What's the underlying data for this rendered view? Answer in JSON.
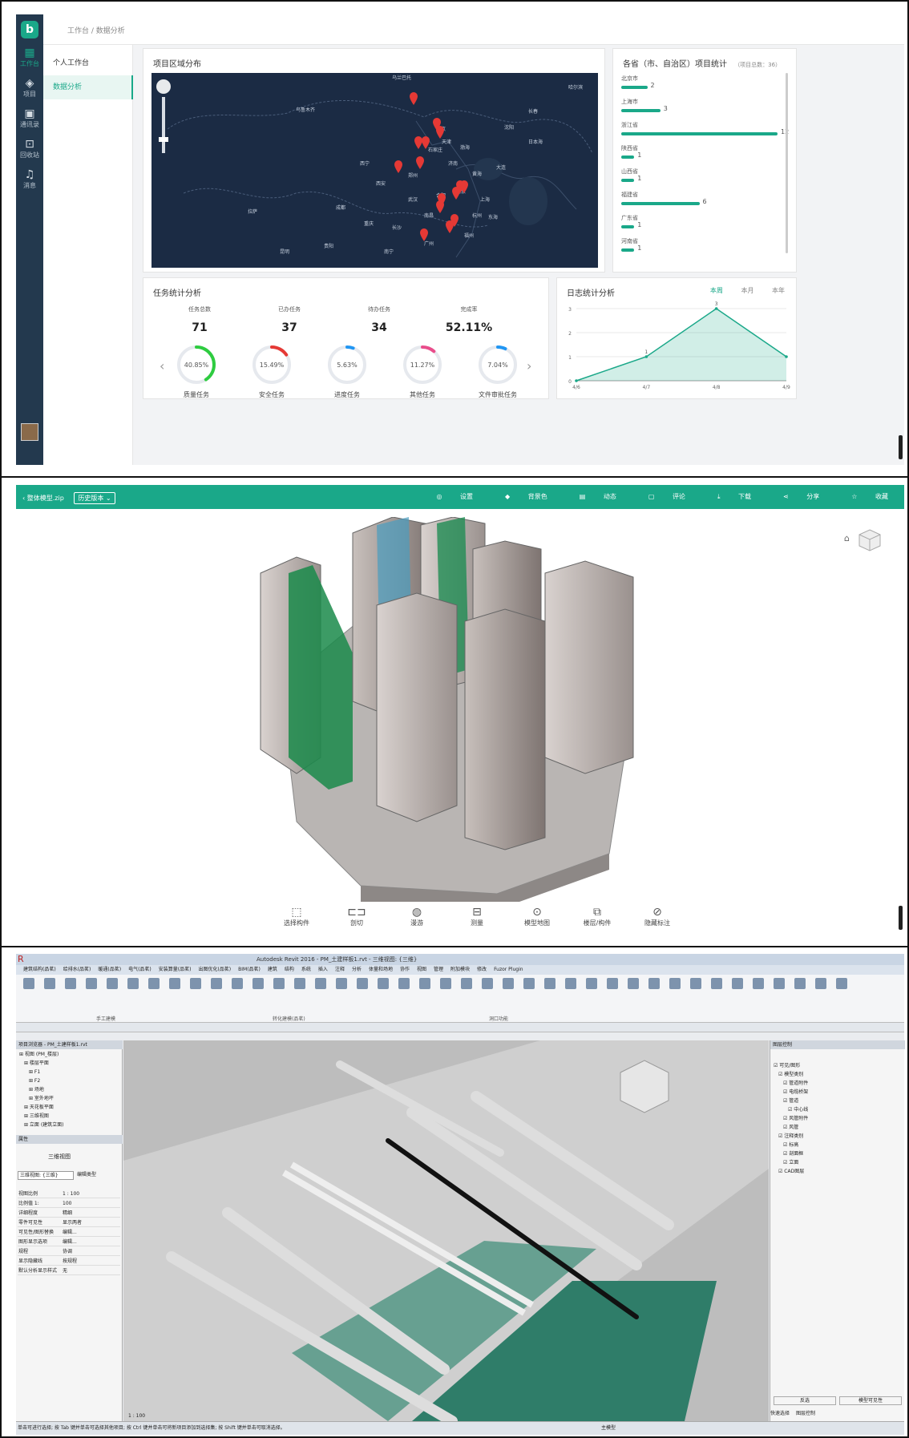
{
  "dashboard": {
    "breadcrumb": "工作台 / 数据分析",
    "sidebar": [
      {
        "label": "工作台",
        "icon": "grid-icon"
      },
      {
        "label": "项目",
        "icon": "layers-icon"
      },
      {
        "label": "通讯录",
        "icon": "contacts-icon"
      },
      {
        "label": "回收站",
        "icon": "trash-icon"
      },
      {
        "label": "消息",
        "icon": "bell-icon"
      }
    ],
    "subnav": [
      "个人工作台",
      "数据分析"
    ],
    "map_card": {
      "title": "项目区域分布",
      "labels": [
        "乌兰巴托",
        "乌鲁木齐",
        "北京",
        "天津",
        "石家庄",
        "渤海",
        "黄海",
        "东海",
        "日本海",
        "上海",
        "西宁",
        "成都",
        "重庆",
        "贵阳",
        "长沙",
        "武汉",
        "南昌",
        "郑州",
        "西安",
        "昆明",
        "拉萨",
        "南宁",
        "广州",
        "福州",
        "杭州",
        "合肥",
        "南京",
        "济南",
        "沈阳",
        "长春",
        "大连",
        "哈尔滨"
      ]
    },
    "province_card": {
      "title": "各省（市、自治区）项目统计",
      "total": "（项目总数：36）",
      "items": [
        {
          "name": "北京市",
          "value": 2
        },
        {
          "name": "上海市",
          "value": 3
        },
        {
          "name": "浙江省",
          "value": 12
        },
        {
          "name": "陕西省",
          "value": 1
        },
        {
          "name": "山西省",
          "value": 1
        },
        {
          "name": "福建省",
          "value": 6
        },
        {
          "name": "广东省",
          "value": 1
        },
        {
          "name": "河南省",
          "value": 1
        }
      ]
    },
    "task_card": {
      "title": "任务统计分析",
      "headers": [
        "任务总数",
        "已办任务",
        "待办任务",
        "完成率"
      ],
      "values": [
        "71",
        "37",
        "34",
        "52.11%"
      ],
      "rings": [
        {
          "label": "质量任务",
          "pct": "40.85%",
          "value": 40.85,
          "color": "#2ecc40"
        },
        {
          "label": "安全任务",
          "pct": "15.49%",
          "value": 15.49,
          "color": "#e53935"
        },
        {
          "label": "进度任务",
          "pct": "5.63%",
          "value": 5.63,
          "color": "#2196f3"
        },
        {
          "label": "其他任务",
          "pct": "11.27%",
          "value": 11.27,
          "color": "#e94d8b"
        },
        {
          "label": "文件审批任务",
          "pct": "7.04%",
          "value": 7.04,
          "color": "#2196f3"
        }
      ],
      "prev": "‹",
      "next": "›"
    },
    "log_card": {
      "title": "日志统计分析",
      "tabs": [
        "本周",
        "本月",
        "本年"
      ],
      "active_tab": "本周"
    }
  },
  "chart_data": {
    "type": "area",
    "title": "日志统计分析",
    "categories": [
      "4/6",
      "4/7",
      "4/8",
      "4/9"
    ],
    "series": [
      {
        "values": [
          0,
          1,
          3,
          1
        ]
      }
    ],
    "ylim": [
      0,
      3
    ],
    "yticks": [
      "0",
      "1",
      "2",
      "3"
    ],
    "data_labels": [
      "1",
      "3"
    ],
    "grid": true,
    "color": "#1aa889"
  },
  "viewer": {
    "file": "整体模型.zip",
    "version": "历史版本",
    "actions": [
      "设置",
      "背景色",
      "动态",
      "评论",
      "下载",
      "分享",
      "收藏"
    ],
    "tools": [
      {
        "label": "选择构件",
        "icon": "select-icon"
      },
      {
        "label": "剖切",
        "icon": "section-icon"
      },
      {
        "label": "漫游",
        "icon": "walk-icon"
      },
      {
        "label": "测量",
        "icon": "measure-icon"
      },
      {
        "label": "模型地图",
        "icon": "map-pin-icon"
      },
      {
        "label": "楼层/构件",
        "icon": "layers-icon"
      },
      {
        "label": "隐藏标注",
        "icon": "hide-icon"
      }
    ]
  },
  "revit": {
    "title": "Autodesk Revit 2016 - PM_土建样板1.rvt - 三维视图: {三维}",
    "menu": [
      "建筑结构(品茗)",
      "给排水(品茗)",
      "暖通(品茗)",
      "电气(品茗)",
      "安装算量(品茗)",
      "出图优化(品茗)",
      "BIM(品茗)",
      "建筑",
      "结构",
      "系统",
      "插入",
      "注释",
      "分析",
      "体量和场地",
      "协作",
      "视图",
      "管理",
      "附加模块",
      "修改",
      "Fuzor Plugin"
    ],
    "ribbon_groups": [
      "手工建模",
      "转化建模(品茗)",
      "洞口功能"
    ],
    "browser_title": "项目浏览器 - PM_土建样板1.rvt",
    "tree": [
      "视图 (PM_楼层)",
      "楼层平面",
      "F1",
      "F2",
      "场地",
      "室外地坪",
      "天花板平面",
      "三维视图",
      "立面 (建筑立面)"
    ],
    "props_title": "属性",
    "view_type": "三维视图",
    "view_selector": "三维视图: {三维}",
    "edit_type": "编辑类型",
    "props": [
      {
        "k": "视图比例",
        "v": "1 : 100"
      },
      {
        "k": "比例值 1:",
        "v": "100"
      },
      {
        "k": "详细程度",
        "v": "精细"
      },
      {
        "k": "零件可见性",
        "v": "显示两者"
      },
      {
        "k": "可见性/图形替换",
        "v": "编辑..."
      },
      {
        "k": "图形显示选项",
        "v": "编辑..."
      },
      {
        "k": "规程",
        "v": "协调"
      },
      {
        "k": "显示隐藏线",
        "v": "按规程"
      },
      {
        "k": "默认分析显示样式",
        "v": "无"
      }
    ],
    "right_title": "图层控制",
    "right_tree": [
      "可见/图形",
      "模型类别",
      "管道附件",
      "电缆桥架",
      "管道",
      "中心线",
      "风管附件",
      "风管",
      "注释类别",
      "标高",
      "剖面框",
      "立面",
      "CAD图层"
    ],
    "right_buttons": [
      "反选",
      "模型可见性"
    ],
    "bottom_tabs": [
      "快速选择",
      "图层控制"
    ],
    "scale": "1 : 100",
    "status": "单击可进行选择; 按 Tab 键并单击可选择其他项目; 按 Ctrl 键并单击可将新项目添加到选择集; 按 Shift 键并单击可取消选择。",
    "level": "主模型"
  }
}
